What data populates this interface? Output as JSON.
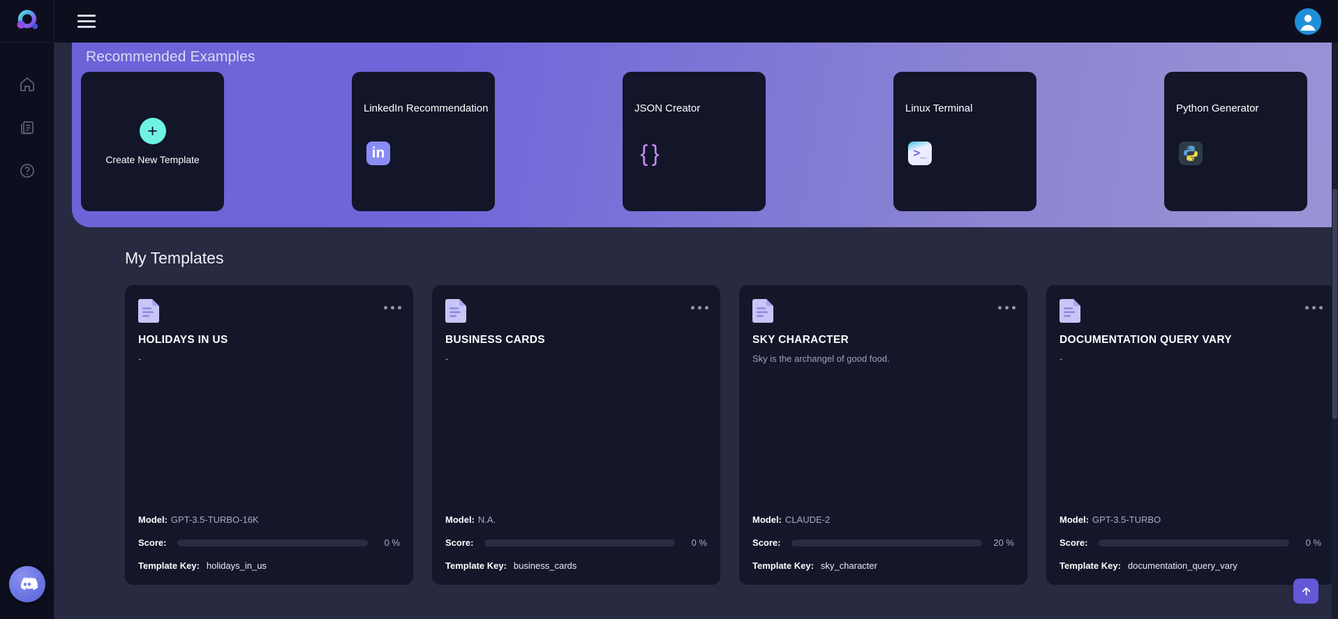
{
  "sidebar": {
    "logo_name": "app-logo",
    "items": [
      {
        "icon": "home-icon",
        "label": "Home"
      },
      {
        "icon": "library-icon",
        "label": "Library"
      },
      {
        "icon": "help-circle-icon",
        "label": "Help"
      }
    ],
    "discord_label": "Discord"
  },
  "topbar": {
    "menu_label": "Menu",
    "avatar_label": "Account"
  },
  "recommended": {
    "title": "Recommended Examples",
    "create": {
      "label": "Create New Template",
      "icon": "plus-icon"
    },
    "cards": [
      {
        "title": "LinkedIn Recommendation",
        "icon": "linkedin-icon",
        "glyph": "in"
      },
      {
        "title": "JSON Creator",
        "icon": "json-braces-icon",
        "glyph": "{ }"
      },
      {
        "title": "Linux Terminal",
        "icon": "terminal-icon",
        "glyph": ">_"
      },
      {
        "title": "Python Generator",
        "icon": "python-icon",
        "glyph": "py"
      }
    ]
  },
  "my_templates": {
    "title": "My Templates",
    "labels": {
      "model": "Model",
      "score": "Score",
      "template_key": "Template Key"
    },
    "cards": [
      {
        "name": "HOLIDAYS IN US",
        "description": "-",
        "model": "GPT-3.5-TURBO-16K",
        "score_percent": 0,
        "score_text": "0 %",
        "template_key": "holidays_in_us"
      },
      {
        "name": "BUSINESS CARDS",
        "description": "-",
        "model": "N.A.",
        "score_percent": 0,
        "score_text": "0 %",
        "template_key": "business_cards"
      },
      {
        "name": "SKY CHARACTER",
        "description": "Sky is the archangel of good food.",
        "model": "CLAUDE-2",
        "score_percent": 20,
        "score_text": "20 %",
        "template_key": "sky_character"
      },
      {
        "name": "DOCUMENTATION QUERY VARY",
        "description": "-",
        "model": "GPT-3.5-TURBO",
        "score_percent": 0,
        "score_text": "0 %",
        "template_key": "documentation_query_vary"
      }
    ]
  },
  "scroll_top": {
    "label": "Scroll to top",
    "icon": "arrow-up-icon"
  },
  "colors": {
    "accent": "#6358d6",
    "banner_from": "#6c63d8",
    "banner_to": "#9a94d6",
    "plus_badge": "#6ff4e4",
    "score_bar": "#f9504b",
    "card_bg": "#141729",
    "page_bg": "#272a40"
  }
}
